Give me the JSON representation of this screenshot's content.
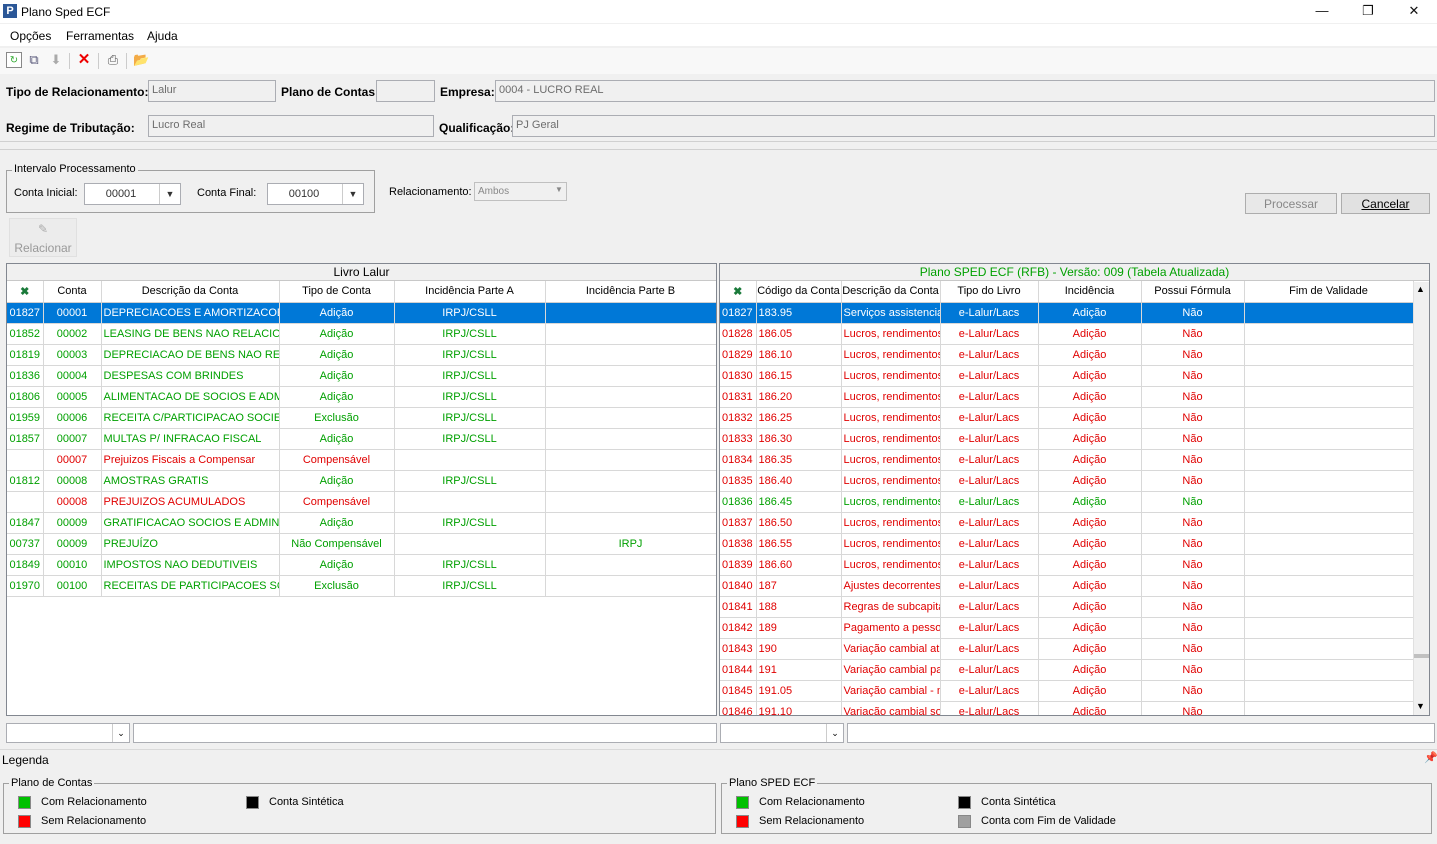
{
  "window": {
    "title": "Plano Sped ECF",
    "app_letter": "P"
  },
  "menu": [
    "Opções",
    "Ferramentas",
    "Ajuda"
  ],
  "toolbar_icons": [
    "refresh-icon",
    "copy-icon",
    "download-icon",
    "delete-icon",
    "print-icon",
    "open-folder-icon"
  ],
  "form": {
    "tipo_label": "Tipo de Relacionamento:",
    "tipo_value": "Lalur",
    "plano_label": "Plano de Contas:",
    "plano_value": "",
    "empresa_label": "Empresa:",
    "empresa_value": "0004 - LUCRO REAL",
    "regime_label": "Regime de Tributação:",
    "regime_value": "Lucro Real",
    "qualificacao_label": "Qualificação:",
    "qualificacao_value": "PJ Geral"
  },
  "intervalo": {
    "title": "Intervalo Processamento",
    "conta_inicial_label": "Conta Inicial:",
    "conta_inicial": "00001",
    "conta_final_label": "Conta Final:",
    "conta_final": "00100",
    "relacionamento_label": "Relacionamento:",
    "relacionamento": "Ambos"
  },
  "buttons": {
    "processar": "Processar",
    "cancelar": "Cancelar",
    "relacionar": "Relacionar"
  },
  "left_grid": {
    "title": "Livro Lalur",
    "columns": [
      "Conta",
      "Descrição da Conta",
      "Tipo de Conta",
      "Incidência Parte A",
      "Incidência Parte B"
    ],
    "rows": [
      [
        "01827",
        "00001",
        "DEPRECIACOES E AMORTIZACOES :",
        "Adição",
        "IRPJ/CSLL",
        "",
        "sel"
      ],
      [
        "01852",
        "00002",
        "LEASING DE BENS NAO RELACIONAI",
        "Adição",
        "IRPJ/CSLL",
        "",
        "green"
      ],
      [
        "01819",
        "00003",
        "DEPRECIACAO DE BENS NAO RELAC",
        "Adição",
        "IRPJ/CSLL",
        "",
        "green"
      ],
      [
        "01836",
        "00004",
        "DESPESAS COM BRINDES",
        "Adição",
        "IRPJ/CSLL",
        "",
        "green"
      ],
      [
        "01806",
        "00005",
        "ALIMENTACAO DE SOCIOS E ADMIN",
        "Adição",
        "IRPJ/CSLL",
        "",
        "green"
      ],
      [
        "01959",
        "00006",
        "RECEITA C/PARTICIPACAO SOCIET",
        "Exclusão",
        "IRPJ/CSLL",
        "",
        "green"
      ],
      [
        "01857",
        "00007",
        "MULTAS P/ INFRACAO FISCAL",
        "Adição",
        "IRPJ/CSLL",
        "",
        "green"
      ],
      [
        "",
        "00007",
        "Prejuizos Fiscais a Compensar",
        "Compensável",
        "",
        "",
        "red"
      ],
      [
        "01812",
        "00008",
        "AMOSTRAS GRATIS",
        "Adição",
        "IRPJ/CSLL",
        "",
        "green"
      ],
      [
        "",
        "00008",
        "PREJUIZOS ACUMULADOS",
        "Compensável",
        "",
        "",
        "red"
      ],
      [
        "01847",
        "00009",
        "GRATIFICACAO SOCIOS E ADMINIS",
        "Adição",
        "IRPJ/CSLL",
        "",
        "green"
      ],
      [
        "00737",
        "00009",
        "PREJUÍZO",
        "Não Compensável",
        "",
        "IRPJ",
        "green"
      ],
      [
        "01849",
        "00010",
        "IMPOSTOS NAO DEDUTIVEIS",
        "Adição",
        "IRPJ/CSLL",
        "",
        "green"
      ],
      [
        "01970",
        "00100",
        "RECEITAS DE PARTICIPACOES SOC",
        "Exclusão",
        "IRPJ/CSLL",
        "",
        "green"
      ]
    ]
  },
  "right_grid": {
    "title": "Plano SPED ECF (RFB) - Versão: 009 (Tabela Atualizada)",
    "columns": [
      "Código da Conta",
      "Descrição da Conta",
      "Tipo do Livro",
      "Incidência",
      "Possui Fórmula",
      "Fim de Validade"
    ],
    "rows": [
      [
        "01827",
        "183.95",
        "Serviços assistencia",
        "e-Lalur/Lacs",
        "Adição",
        "Não",
        "",
        "sel"
      ],
      [
        "01828",
        "186.05",
        "Lucros, rendimentos",
        "e-Lalur/Lacs",
        "Adição",
        "Não",
        "",
        "red"
      ],
      [
        "01829",
        "186.10",
        "Lucros, rendimentos",
        "e-Lalur/Lacs",
        "Adição",
        "Não",
        "",
        "red"
      ],
      [
        "01830",
        "186.15",
        "Lucros, rendimentos",
        "e-Lalur/Lacs",
        "Adição",
        "Não",
        "",
        "red"
      ],
      [
        "01831",
        "186.20",
        "Lucros, rendimentos",
        "e-Lalur/Lacs",
        "Adição",
        "Não",
        "",
        "red"
      ],
      [
        "01832",
        "186.25",
        "Lucros, rendimentos",
        "e-Lalur/Lacs",
        "Adição",
        "Não",
        "",
        "red"
      ],
      [
        "01833",
        "186.30",
        "Lucros, rendimentos",
        "e-Lalur/Lacs",
        "Adição",
        "Não",
        "",
        "red"
      ],
      [
        "01834",
        "186.35",
        "Lucros, rendimentos",
        "e-Lalur/Lacs",
        "Adição",
        "Não",
        "",
        "red"
      ],
      [
        "01835",
        "186.40",
        "Lucros, rendimentos",
        "e-Lalur/Lacs",
        "Adição",
        "Não",
        "",
        "red"
      ],
      [
        "01836",
        "186.45",
        "Lucros, rendimentos",
        "e-Lalur/Lacs",
        "Adição",
        "Não",
        "",
        "green"
      ],
      [
        "01837",
        "186.50",
        "Lucros, rendimentos",
        "e-Lalur/Lacs",
        "Adição",
        "Não",
        "",
        "red"
      ],
      [
        "01838",
        "186.55",
        "Lucros, rendimentos",
        "e-Lalur/Lacs",
        "Adição",
        "Não",
        "",
        "red"
      ],
      [
        "01839",
        "186.60",
        "Lucros, rendimentos",
        "e-Lalur/Lacs",
        "Adição",
        "Não",
        "",
        "red"
      ],
      [
        "01840",
        "187",
        "Ajustes decorrentes",
        "e-Lalur/Lacs",
        "Adição",
        "Não",
        "",
        "red"
      ],
      [
        "01841",
        "188",
        "Regras de subcapita",
        "e-Lalur/Lacs",
        "Adição",
        "Não",
        "",
        "red"
      ],
      [
        "01842",
        "189",
        "Pagamento a pessoa",
        "e-Lalur/Lacs",
        "Adição",
        "Não",
        "",
        "red"
      ],
      [
        "01843",
        "190",
        "Variação cambial ativ",
        "e-Lalur/Lacs",
        "Adição",
        "Não",
        "",
        "red"
      ],
      [
        "01844",
        "191",
        "Variação cambial pas",
        "e-Lalur/Lacs",
        "Adição",
        "Não",
        "",
        "red"
      ],
      [
        "01845",
        "191.05",
        "Variação cambial - m",
        "e-Lalur/Lacs",
        "Adição",
        "Não",
        "",
        "red"
      ],
      [
        "01846",
        "191.10",
        "Variação cambial sob",
        "e-Lalur/Lacs",
        "Adição",
        "Não",
        "",
        "red"
      ]
    ]
  },
  "legend": {
    "bar_label": "Legenda",
    "pin_icon": "pin-icon",
    "left": {
      "title": "Plano de Contas",
      "items": [
        {
          "label": "Com Relacionamento",
          "color": "#00c000"
        },
        {
          "label": "Sem Relacionamento",
          "color": "#ff0000"
        },
        {
          "label": "Conta Sintética",
          "color": "#000000"
        }
      ]
    },
    "right": {
      "title": "Plano SPED ECF",
      "items": [
        {
          "label": "Com Relacionamento",
          "color": "#00c000"
        },
        {
          "label": "Sem Relacionamento",
          "color": "#ff0000"
        },
        {
          "label": "Conta Sintética",
          "color": "#000000"
        },
        {
          "label": "Conta com Fim de Validade",
          "color": "#a0a0a0"
        }
      ]
    }
  }
}
